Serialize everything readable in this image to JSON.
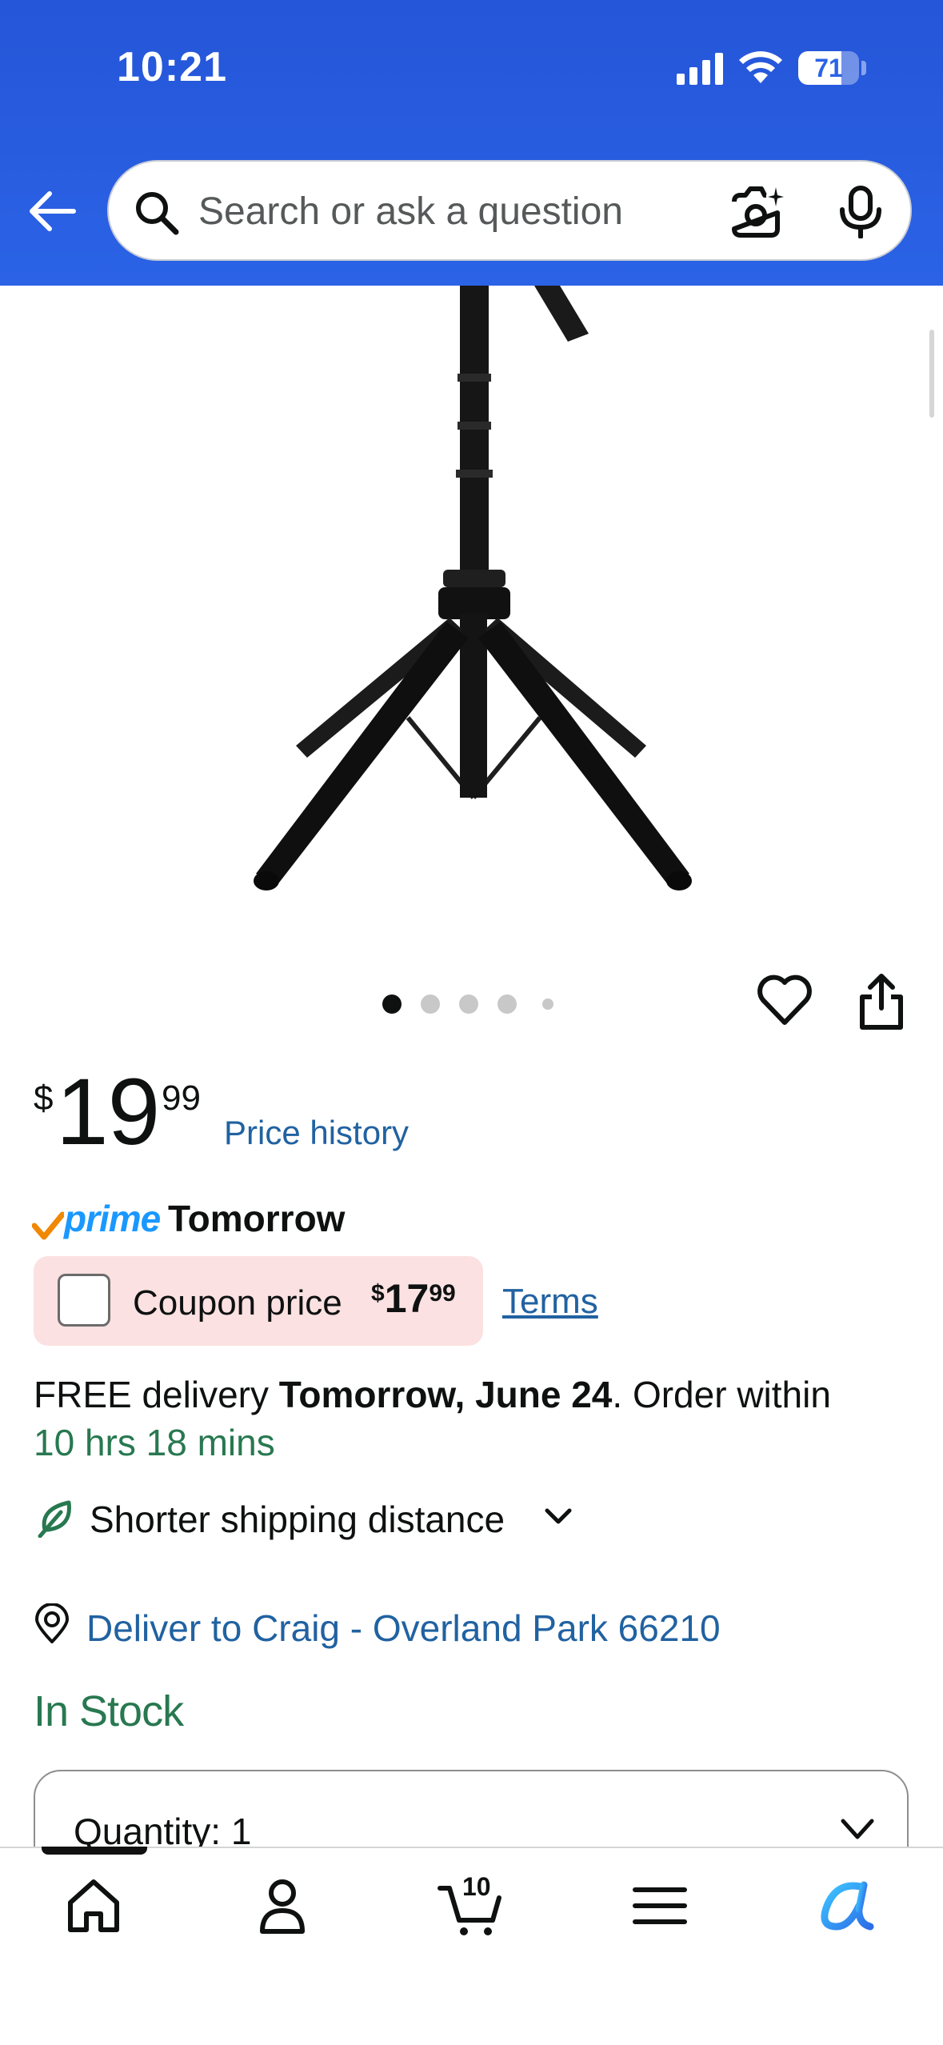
{
  "status_bar": {
    "time": "10:21",
    "battery_level": "71",
    "battery_fraction": 0.71
  },
  "header": {
    "search_placeholder": "Search or ask a question",
    "background_color": "#2b63e6"
  },
  "carousel": {
    "dot_count": 5,
    "active_index": 0
  },
  "price": {
    "symbol": "$",
    "whole": "19",
    "fraction": "99",
    "history_label": "Price history"
  },
  "prime": {
    "brand": "prime",
    "delivery_day": "Tomorrow"
  },
  "coupon": {
    "label": "Coupon price",
    "price_symbol": "$",
    "price_whole": "17",
    "price_fraction": "99",
    "terms_label": "Terms",
    "checked": false
  },
  "delivery": {
    "prefix": "FREE delivery ",
    "date": "Tomorrow, June 24",
    "suffix": ". Order within",
    "countdown": "10 hrs 18 mins",
    "shipping_label": "Shorter shipping distance",
    "deliver_to": "Deliver to Craig - Overland Park 66210"
  },
  "stock": {
    "status": "In Stock",
    "color": "#287850"
  },
  "quantity": {
    "label": "Quantity:",
    "value": "1"
  },
  "bottom_nav": {
    "cart_count": "10",
    "items": [
      "home-icon",
      "account-icon",
      "cart-icon",
      "menu-icon",
      "rufus-icon"
    ]
  },
  "colors": {
    "link": "#2162a1",
    "coupon_bg": "#fbe1e1",
    "prime_blue": "#1a98ff"
  }
}
